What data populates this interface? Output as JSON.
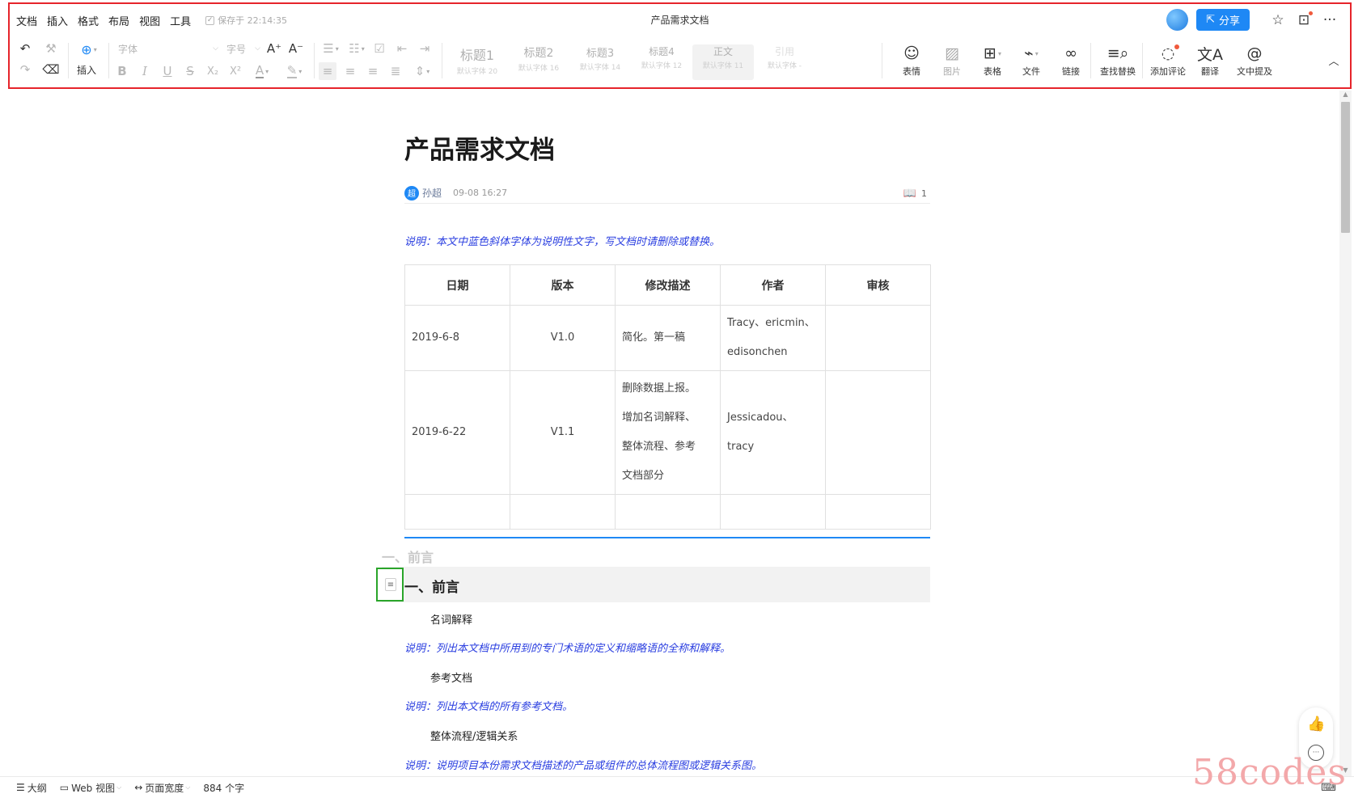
{
  "menubar": {
    "items": [
      "文档",
      "插入",
      "格式",
      "布局",
      "视图",
      "工具"
    ],
    "saved": "保存于 22:14:35"
  },
  "header": {
    "title": "产品需求文档",
    "share_label": "分享"
  },
  "toolbar": {
    "insert_label": "插入",
    "font_placeholder": "字体",
    "size_placeholder": "字号",
    "styles": [
      {
        "name": "标题1",
        "sub": "默认字体 20"
      },
      {
        "name": "标题2",
        "sub": "默认字体 16"
      },
      {
        "name": "标题3",
        "sub": "默认字体 14"
      },
      {
        "name": "标题4",
        "sub": "默认字体 12"
      },
      {
        "name": "正文",
        "sub": "默认字体 11"
      },
      {
        "name": "引用",
        "sub": "默认字体 -"
      }
    ],
    "tools": [
      "表情",
      "图片",
      "表格",
      "文件",
      "链接",
      "查找替换",
      "添加评论",
      "翻译",
      "文中提及"
    ]
  },
  "document": {
    "title": "产品需求文档",
    "author_initial": "超",
    "author": "孙超",
    "edit_time": "09-08 16:27",
    "read_count": "1",
    "note_top": "说明：本文中蓝色斜体字体为说明性文字，写文档时请删除或替换。",
    "table": {
      "headers": [
        "日期",
        "版本",
        "修改描述",
        "作者",
        "审核"
      ],
      "rows": [
        {
          "date": "2019-6-8",
          "version": "V1.0",
          "desc": [
            "简化。第一稿"
          ],
          "author": [
            "Tracy、ericmin、",
            "edisonchen"
          ],
          "review": ""
        },
        {
          "date": "2019-6-22",
          "version": "V1.1",
          "desc": [
            "删除数据上报。",
            "增加名词解释、",
            "整体流程、参考",
            "文档部分"
          ],
          "author": [
            "Jessicadou、",
            "tracy"
          ],
          "review": ""
        }
      ]
    },
    "ghost_heading": "一、前言",
    "heading1": "一、前言",
    "sections": [
      {
        "title": "名词解释",
        "note": "说明：列出本文档中所用到的专门术语的定义和缩略语的全称和解释。"
      },
      {
        "title": "参考文档",
        "note": "说明：列出本文档的所有参考文档。"
      },
      {
        "title": "整体流程/逻辑关系",
        "note": "说明：说明项目本份需求文档描述的产品或组件的总体流程图或逻辑关系图。"
      }
    ]
  },
  "statusbar": {
    "outline": "大纲",
    "view": "Web 视图",
    "width": "页面宽度",
    "word_count": "884 个字"
  },
  "watermark": "58codes"
}
